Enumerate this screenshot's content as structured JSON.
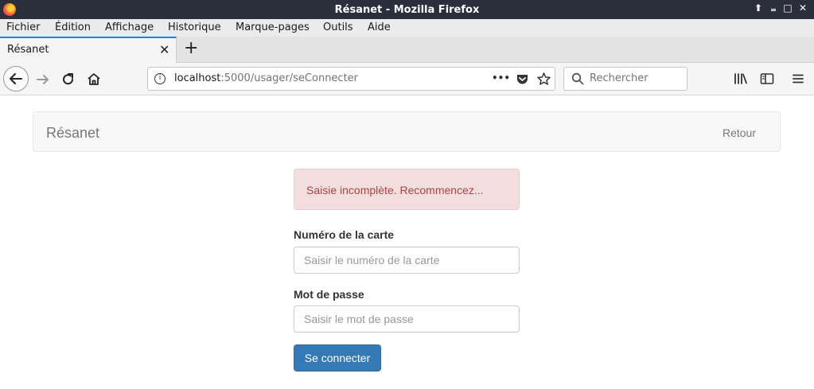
{
  "window": {
    "title": "Résanet - Mozilla Firefox",
    "controls": [
      "⬆",
      "‗",
      "□",
      "✕"
    ]
  },
  "menubar": [
    "Fichier",
    "Édition",
    "Affichage",
    "Historique",
    "Marque-pages",
    "Outils",
    "Aide"
  ],
  "tab": {
    "label": "Résanet",
    "close": "✕",
    "new_tab": "+"
  },
  "urlbar": {
    "host": "localhost",
    "path": ":5000/usager/seConnecter",
    "more": "•••"
  },
  "search": {
    "placeholder": "Rechercher"
  },
  "page": {
    "brand": "Résanet",
    "retour": "Retour",
    "alert": "Saisie incomplète. Recommencez...",
    "card_label": "Numéro de la carte",
    "card_placeholder": "Saisir le numéro de la carte",
    "password_label": "Mot de passe",
    "password_placeholder": "Saisir le mot de passe",
    "submit": "Se connecter"
  },
  "colors": {
    "titlebar": "#2b2e3b",
    "tab_accent": "#0a84ff",
    "alert_bg": "#f2dede",
    "alert_text": "#a94442",
    "button": "#337ab7"
  },
  "icons": [
    "firefox-logo",
    "back-icon",
    "forward-icon",
    "reload-icon",
    "home-icon",
    "info-icon",
    "page-actions-icon",
    "pocket-icon",
    "bookmark-star-icon",
    "search-icon",
    "library-icon",
    "sidebar-icon",
    "menu-icon"
  ]
}
